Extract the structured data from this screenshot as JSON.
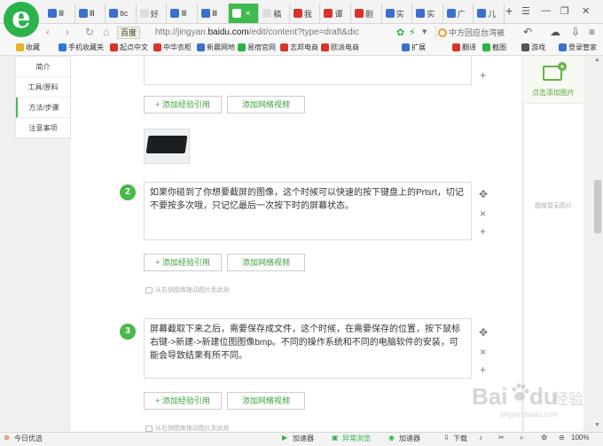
{
  "browser": {
    "tabs": [
      {
        "label": "Ⅲ",
        "color": "#3b6fd1"
      },
      {
        "label": "Ⅲ",
        "color": "#3b6fd1"
      },
      {
        "label": "tic",
        "color": "#3b6fd1"
      },
      {
        "label": "好",
        "color": "#dddddd"
      },
      {
        "label": "Ⅲ",
        "color": "#3b6fd1"
      },
      {
        "label": "Ⅲ",
        "color": "#3b6fd1"
      },
      {
        "label": "",
        "color": "#ffffff",
        "active": true
      },
      {
        "label": "稿",
        "color": "#dddddd"
      },
      {
        "label": "我",
        "color": "#d9332a"
      },
      {
        "label": "谭",
        "color": "#d9332a"
      },
      {
        "label": "剧",
        "color": "#d9332a"
      },
      {
        "label": "实",
        "color": "#3b6fd1"
      },
      {
        "label": "实",
        "color": "#3b6fd1"
      },
      {
        "label": "广",
        "color": "#3b6fd1"
      },
      {
        "label": "儿",
        "color": "#3b6fd1"
      }
    ],
    "search_engine_badge": "百度",
    "url_prefix": "http://jingyan.",
    "url_domain": "baidu.com",
    "url_suffix": "/edit/content?type=draft&dic",
    "search_text": "中方回应台湾被驱",
    "bookmarks": [
      "收藏",
      "手机收藏夹",
      "起点中文",
      "中华衣柜",
      "新晨网地",
      "易宿官网",
      "志邦电商",
      "欧派电商",
      "扩展",
      "翻译",
      "截图",
      "游戏",
      "登录管家"
    ]
  },
  "sidebar": {
    "items": [
      "简介",
      "工具/原料",
      "方法/步骤",
      "注意事项"
    ]
  },
  "editor": {
    "add_ref_label": "+ 添加经验引用",
    "add_video_label": "添加网络视频",
    "drag_hint": "从右侧图库拖动图片到此处",
    "steps": [
      {
        "number": "2",
        "text": "如果你碰到了你想要截屏的图像，这个时候可以快速的按下键盘上的Prtsrt，切记不要按多次哦，只记忆最后一次按下时的屏幕状态。"
      },
      {
        "number": "3",
        "text": "屏幕截取下来之后，需要保存成文件，这个时候，在需要保存的位置，按下鼠标右键->新建->新建位图图像bmp。不同的操作系统和不同的电脑软件的安装，可能会导致结果有所不同。"
      }
    ]
  },
  "right_panel": {
    "add_image_label": "点击添加图片",
    "empty_label": "图库暂无图片"
  },
  "watermark": {
    "brand": "Bai",
    "brand2": "du",
    "jingyan": "经验",
    "url": "jingyan.baidu.com"
  },
  "statusbar": {
    "left": "今日优选",
    "quick_open": "加速器",
    "fast_browse": "异常浏览",
    "download": "下载",
    "zoom": "100%"
  }
}
